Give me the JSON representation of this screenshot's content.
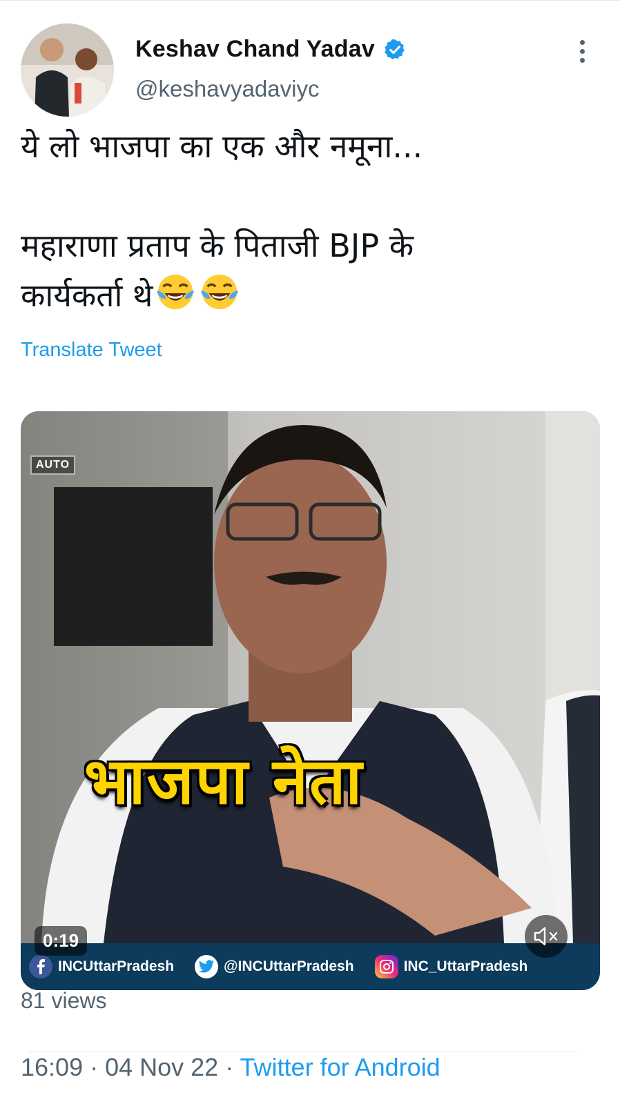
{
  "tweet": {
    "author_name": "Keshav Chand Yadav",
    "verified_icon": "verified-badge-icon",
    "handle": "@keshavyadaviyc",
    "text_line1": "ये लो भाजपा का एक और नमूना...",
    "text_line2": "महाराणा प्रताप के पिताजी BJP के",
    "text_line3": "कार्यकर्ता थे",
    "emoji": [
      "face-with-tears-of-joy",
      "face-with-tears-of-joy"
    ],
    "translate_label": "Translate Tweet",
    "views": "81 views",
    "time": "16:09",
    "date": "04 Nov 22",
    "separator": " · ",
    "source": "Twitter for Android"
  },
  "media": {
    "auto_label": "AUTO",
    "caption": "भाजपा नेता",
    "duration": "0:19",
    "strip": {
      "facebook": "INCUttarPradesh",
      "twitter": "@INCUttarPradesh",
      "instagram": "INC_UttarPradesh"
    },
    "mute_icon": "muted-speaker-icon"
  },
  "colors": {
    "link": "#1d9bf0",
    "secondary_text": "#536471",
    "caption_yellow": "#ffd400",
    "strip_bg": "#0c3b5c"
  }
}
